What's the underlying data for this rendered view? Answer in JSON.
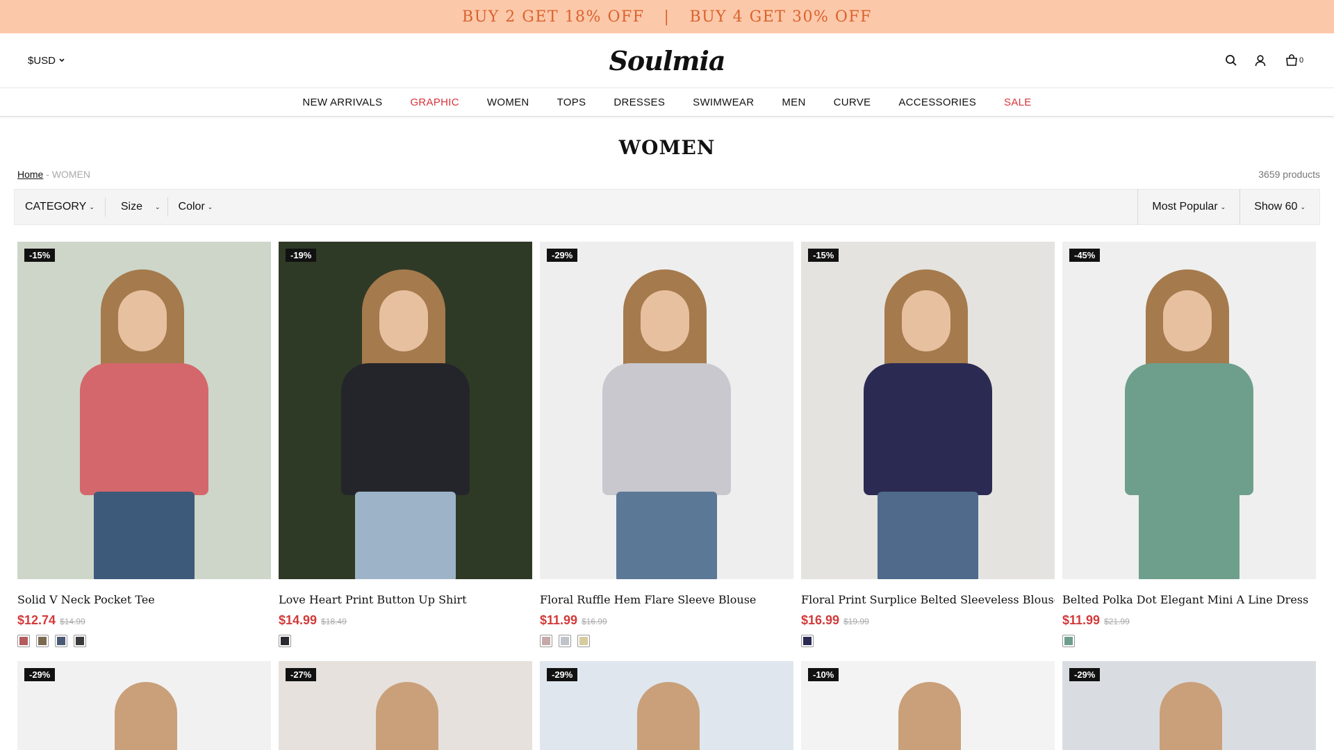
{
  "promo": {
    "left": "BUY 2 GET 18% OFF",
    "divider": "|",
    "right": "BUY 4 GET 30% OFF"
  },
  "header": {
    "currency": "$USD",
    "logo": "Soulmia",
    "cart_count": "0"
  },
  "nav": [
    "NEW ARRIVALS",
    "GRAPHIC",
    "WOMEN",
    "TOPS",
    "DRESSES",
    "SWIMWEAR",
    "MEN",
    "CURVE",
    "ACCESSORIES",
    "SALE"
  ],
  "page": {
    "title": "WOMEN",
    "breadcrumb_home": "Home",
    "breadcrumb_sep": "-",
    "breadcrumb_current": "WOMEN",
    "product_count": "3659 products"
  },
  "filters": {
    "category": "CATEGORY",
    "size": "Size",
    "color": "Color",
    "sort": "Most Popular",
    "show": "Show 60"
  },
  "products": [
    {
      "badge": "-15%",
      "name": "Solid V Neck Pocket Tee",
      "price": "$12.74",
      "old": "$14.99",
      "bg": "#cdd6c9",
      "top": "#d4676b",
      "bottom": "#3d5a7a",
      "swatches": [
        "#b45b5e",
        "#7a6a50",
        "#4b5a75",
        "#3b3b3b"
      ]
    },
    {
      "badge": "-19%",
      "name": "Love Heart Print Button Up Shirt",
      "price": "$14.99",
      "old": "$18.49",
      "bg": "#2f3a26",
      "top": "#24252b",
      "bottom": "#9db4c8",
      "swatches": [
        "#2a2a30"
      ]
    },
    {
      "badge": "-29%",
      "name": "Floral Ruffle Hem Flare Sleeve Blouse",
      "price": "$11.99",
      "old": "$16.99",
      "bg": "#eeeeee",
      "top": "#c9c8cf",
      "bottom": "#5b7896",
      "swatches": [
        "#c7a9a9",
        "#c0c3ca",
        "#d7cba0"
      ]
    },
    {
      "badge": "-15%",
      "name": "Floral Print Surplice Belted Sleeveless Blouse",
      "price": "$16.99",
      "old": "$19.99",
      "bg": "#e4e3df",
      "top": "#2b2a52",
      "bottom": "#4f6a8a",
      "swatches": [
        "#2b2a52"
      ]
    },
    {
      "badge": "-45%",
      "name": "Belted Polka Dot Elegant Mini A Line Dress",
      "price": "$11.99",
      "old": "$21.99",
      "bg": "#efefef",
      "top": "#6e9f8d",
      "bottom": "#6e9f8d",
      "swatches": [
        "#6e9f8d"
      ]
    }
  ],
  "row2": [
    {
      "badge": "-29%",
      "bg": "#f1f1f1"
    },
    {
      "badge": "-27%",
      "bg": "#e6e1dc"
    },
    {
      "badge": "-29%",
      "bg": "#dfe6ee"
    },
    {
      "badge": "-10%",
      "bg": "#f3f3f3"
    },
    {
      "badge": "-29%",
      "bg": "#d9dde2"
    }
  ]
}
